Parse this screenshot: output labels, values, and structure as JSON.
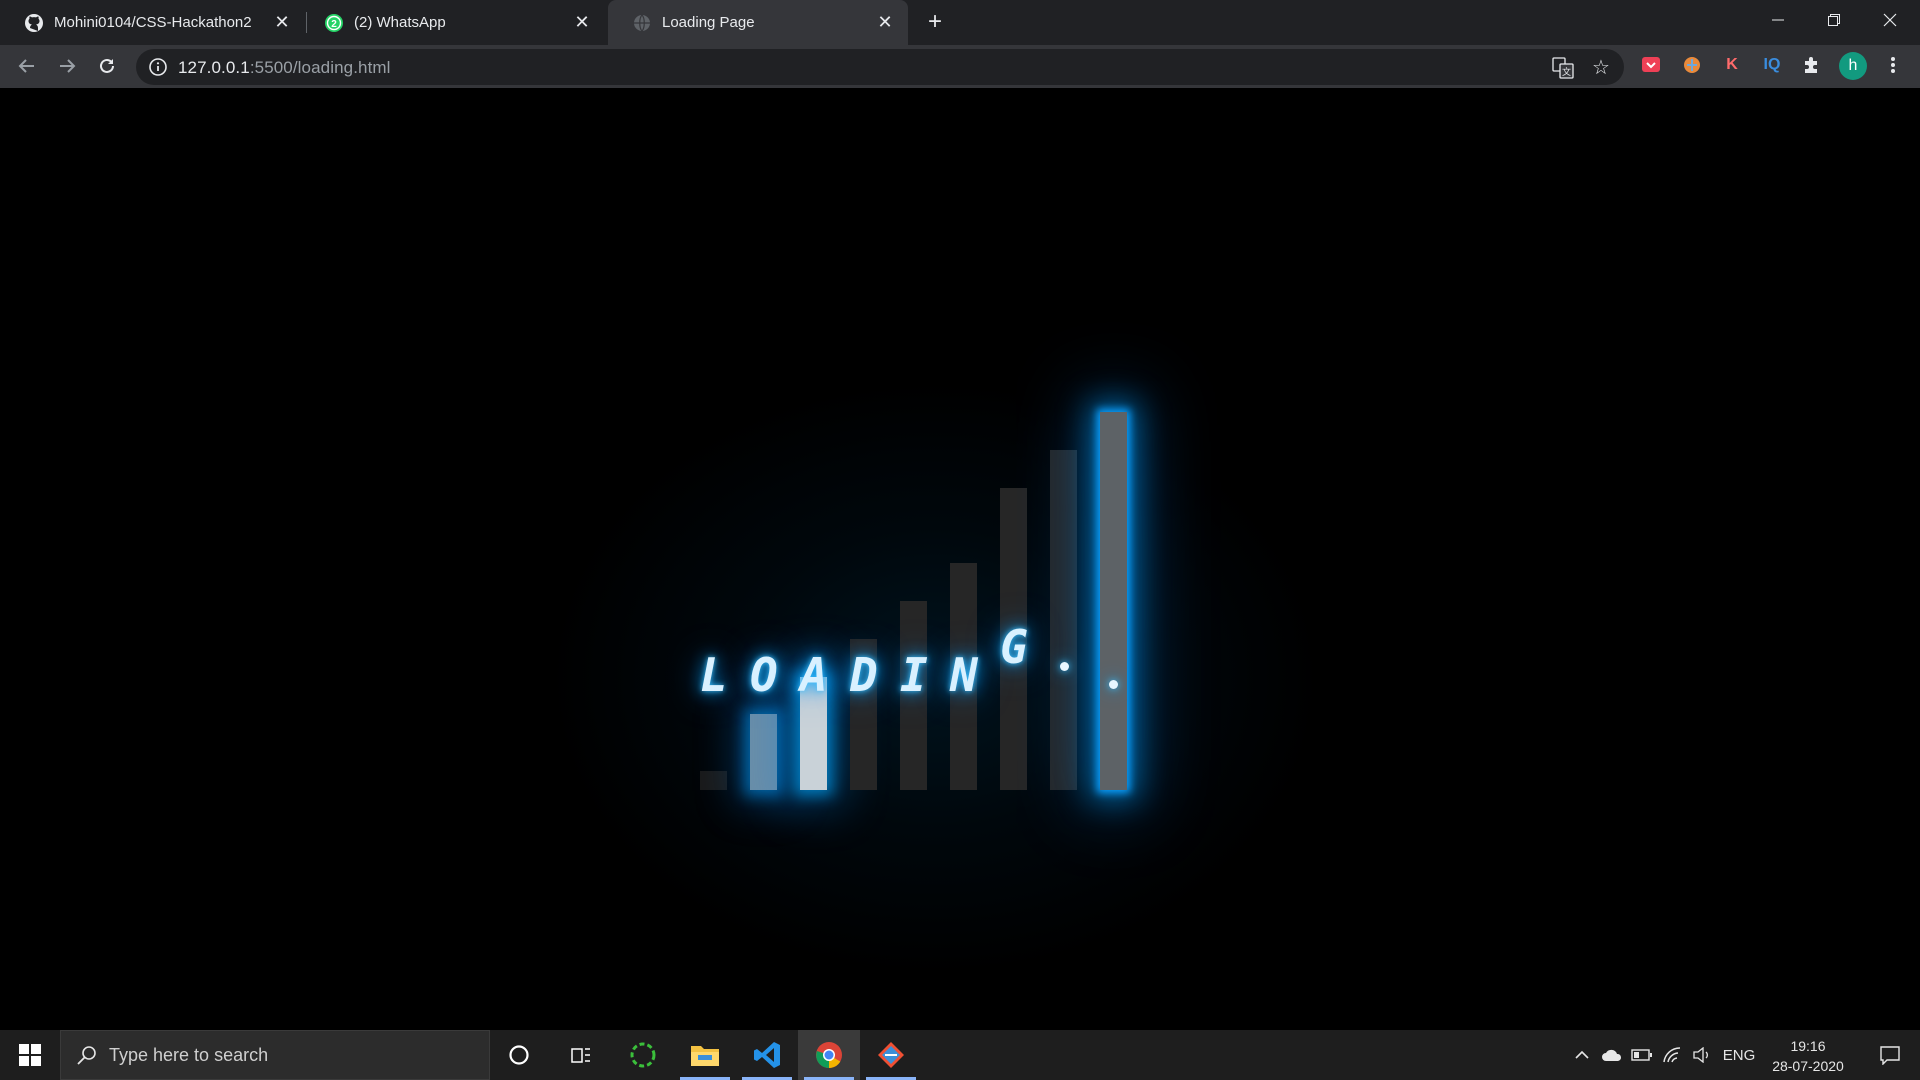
{
  "browser": {
    "tabs": [
      {
        "title": "Mohini0104/CSS-Hackathon2",
        "icon": "github-icon",
        "active": false
      },
      {
        "title": "(2) WhatsApp",
        "icon": "whatsapp-icon",
        "badge": "2",
        "active": false
      },
      {
        "title": "Loading Page",
        "icon": "globe-icon",
        "active": true
      }
    ],
    "address": {
      "host": "127.0.0.1",
      "rest": ":5500/loading.html"
    },
    "profile_initial": "h",
    "extensions": [
      {
        "name": "pocket-extension-icon",
        "color": "#ef4056"
      },
      {
        "name": "brain-extension-icon",
        "color": "#e88a3c"
      },
      {
        "name": "k-extension-icon",
        "label": "K",
        "color": "#ff6b6b"
      },
      {
        "name": "iq-extension-icon",
        "label": "IQ",
        "color": "#3a8dde"
      },
      {
        "name": "puzzle-extensions-icon",
        "color": "#e8eaed"
      }
    ]
  },
  "page": {
    "loading_letters": [
      "L",
      "O",
      "A",
      "D",
      "I",
      "N",
      "G"
    ],
    "glow_color": "#0aa0ff",
    "bars": [
      {
        "level": 0.05,
        "state": "dimmer"
      },
      {
        "level": 0.2,
        "state": "mid"
      },
      {
        "level": 0.3,
        "state": "bright"
      },
      {
        "level": 0.4,
        "state": "dim"
      },
      {
        "level": 0.5,
        "state": "dim"
      },
      {
        "level": 0.6,
        "state": "dim"
      },
      {
        "level": 0.8,
        "state": "dim"
      },
      {
        "level": 0.9,
        "state": "dim"
      },
      {
        "level": 1.0,
        "state": "lit"
      }
    ]
  },
  "taskbar": {
    "search_placeholder": "Type here to search",
    "language": "ENG",
    "time": "19:16",
    "date": "28-07-2020"
  }
}
